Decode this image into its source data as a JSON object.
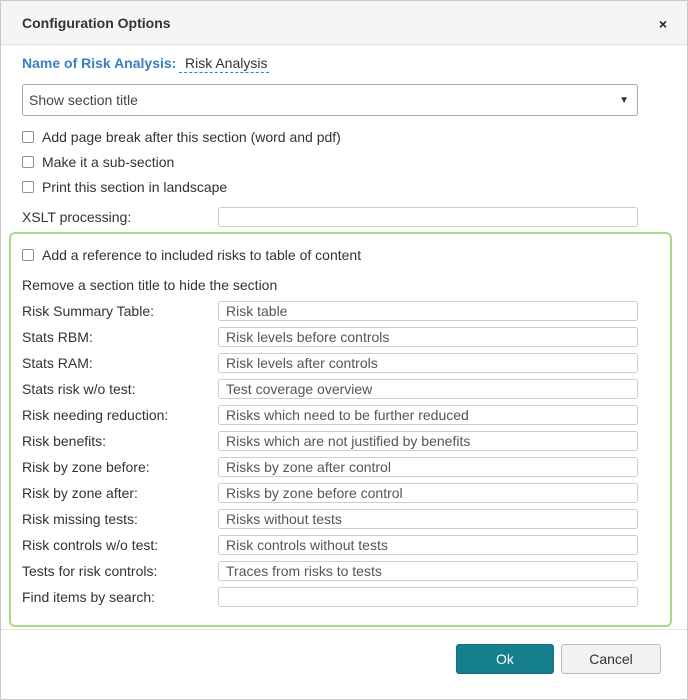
{
  "dialog": {
    "title": "Configuration Options",
    "close_icon": "×"
  },
  "name": {
    "label": "Name of Risk Analysis:",
    "value": "Risk Analysis"
  },
  "select": {
    "value": "Show section title",
    "caret": "▼"
  },
  "options": [
    {
      "label": "Add page break after this section (word and pdf)",
      "checked": false
    },
    {
      "label": "Make it a sub-section",
      "checked": false
    },
    {
      "label": "Print this section in landscape",
      "checked": false
    }
  ],
  "xslt": {
    "label": "XSLT processing:",
    "value": ""
  },
  "section_box": {
    "reference_checkbox": {
      "label": "Add a reference to included risks to table of content",
      "checked": false
    },
    "hint": "Remove a section title to hide the section",
    "fields": [
      {
        "label": "Risk Summary Table:",
        "value": "Risk table"
      },
      {
        "label": "Stats RBM:",
        "value": "Risk levels before controls"
      },
      {
        "label": "Stats RAM:",
        "value": "Risk levels after controls"
      },
      {
        "label": "Stats risk w/o test:",
        "value": "Test coverage overview"
      },
      {
        "label": "Risk needing reduction:",
        "value": "Risks which need to be further reduced"
      },
      {
        "label": "Risk benefits:",
        "value": "Risks which are not justified by benefits"
      },
      {
        "label": "Risk by zone before:",
        "value": "Risks by zone after control"
      },
      {
        "label": "Risk by zone after:",
        "value": "Risks by zone before control"
      },
      {
        "label": "Risk missing tests:",
        "value": "Risks without tests"
      },
      {
        "label": "Risk controls w/o test:",
        "value": "Risk controls without tests"
      },
      {
        "label": "Tests for risk controls:",
        "value": "Traces from risks to tests"
      },
      {
        "label": "Find items by search:",
        "value": ""
      }
    ]
  },
  "footer": {
    "ok_label": "Ok",
    "cancel_label": "Cancel"
  },
  "colors": {
    "accent_blue": "#3a7fc4",
    "ok_button": "#157f8e",
    "green_border": "#a8d98a"
  }
}
